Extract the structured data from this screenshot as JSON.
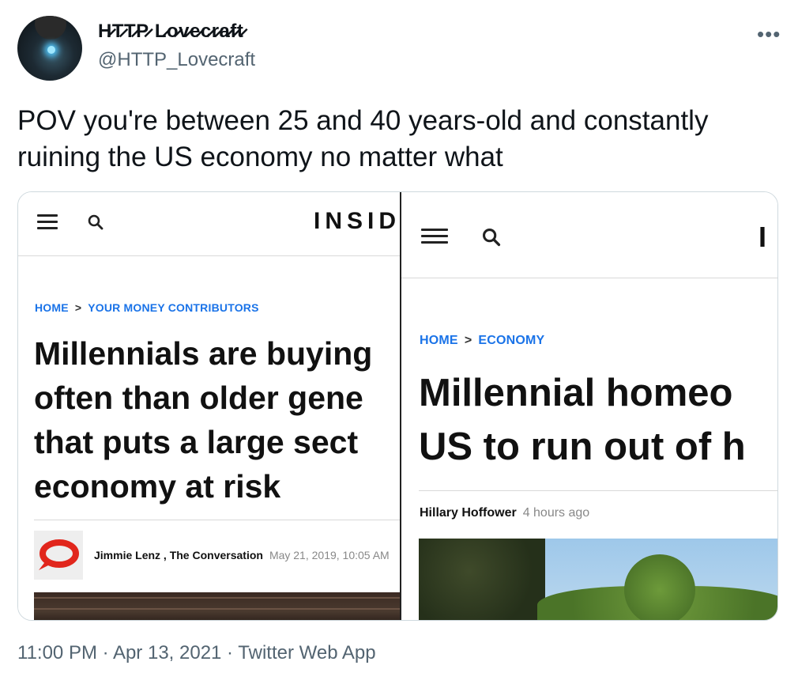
{
  "tweet": {
    "display_name": "H̷T̷T̷P̷ L̷o̷v̷e̷c̷r̷a̷f̷t̷",
    "handle": "@HTTP_Lovecraft",
    "more_label": "•••",
    "text": "POV you're between 25 and 40 years-old and constantly ruining the US economy no matter what",
    "timestamp": "11:00 PM · Apr 13, 2021 · Twitter Web App"
  },
  "screenshot_left": {
    "logo": "INSID",
    "breadcrumb_home": "HOME",
    "breadcrumb_sep": ">",
    "breadcrumb_section": "YOUR MONEY CONTRIBUTORS",
    "headline_lines": [
      "Millennials are buying",
      "often than older gene",
      "that puts a large sect",
      "economy at risk"
    ],
    "byline": "Jimmie Lenz , The Conversation",
    "date": "May 21, 2019, 10:05 AM"
  },
  "screenshot_right": {
    "logo": "I",
    "breadcrumb_home": "HOME",
    "breadcrumb_sep": ">",
    "breadcrumb_section": "ECONOMY",
    "headline_lines": [
      "Millennial homeo",
      "US to run out of h"
    ],
    "byline": "Hillary Hoffower",
    "date": "4 hours ago"
  },
  "colors": {
    "link_blue": "#1a73e8",
    "secondary_text": "#536471",
    "conversation_logo": "#e1261c"
  },
  "icons": [
    "hamburger-menu-icon",
    "search-icon",
    "conversation-logo-icon"
  ]
}
